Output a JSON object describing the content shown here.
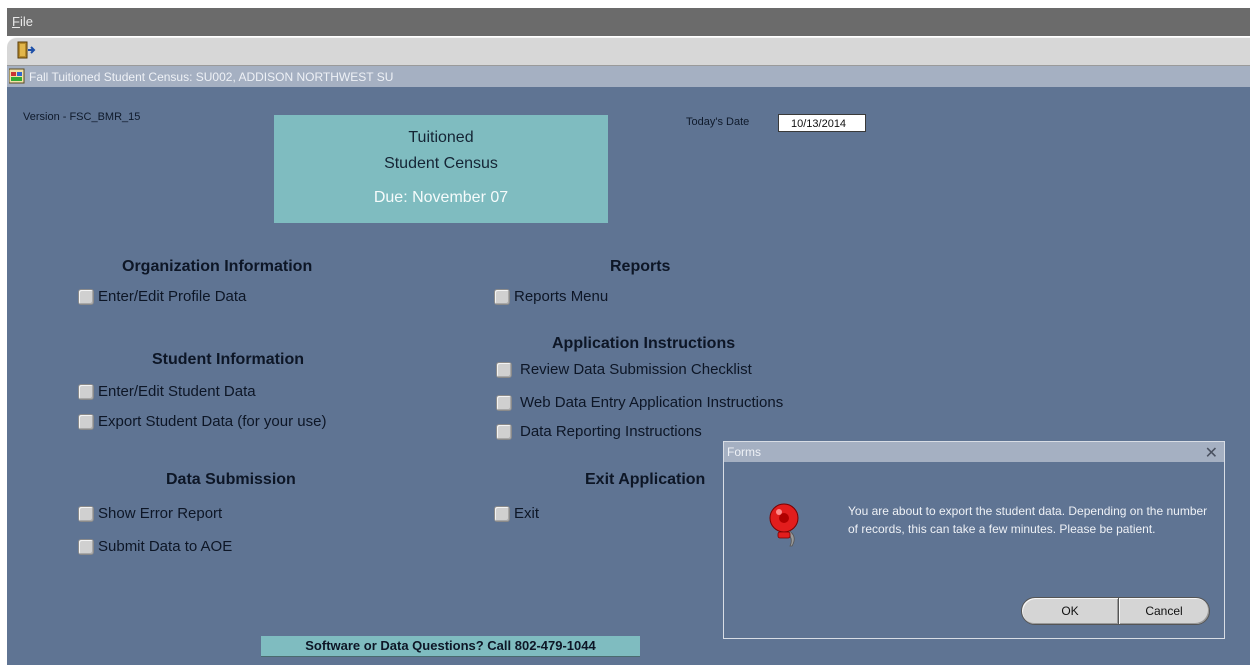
{
  "menu": {
    "file": "File"
  },
  "window_title": "Fall Tuitioned Student Census:  SU002, ADDISON NORTHWEST SU",
  "version": "Version - FSC_BMR_15",
  "banner": {
    "line1": "Tuitioned",
    "line2": "Student Census",
    "due": "Due:  November 07"
  },
  "today_label": "Today's Date",
  "today_value": "10/13/2014",
  "sections": {
    "org": {
      "title": "Organization Information",
      "items": [
        "Enter/Edit Profile Data"
      ]
    },
    "student": {
      "title": "Student Information",
      "items": [
        "Enter/Edit Student Data",
        "Export Student Data (for your use)"
      ]
    },
    "submission": {
      "title": "Data Submission",
      "items": [
        "Show Error Report",
        "Submit Data to AOE"
      ]
    },
    "reports": {
      "title": "Reports",
      "items": [
        "Reports Menu"
      ]
    },
    "instructions": {
      "title": "Application Instructions",
      "items": [
        "Review Data Submission Checklist",
        "Web Data Entry Application Instructions",
        "Data Reporting Instructions"
      ]
    },
    "exit": {
      "title": "Exit Application",
      "items": [
        "Exit"
      ]
    }
  },
  "footer": "Software or Data Questions?  Call 802-479-1044",
  "dialog": {
    "title": "Forms",
    "message": "You are about to export the student data.  Depending on the number of records, this can take a few minutes. Please be patient.",
    "ok": "OK",
    "cancel": "Cancel"
  },
  "colors": {
    "background": "#5f7493",
    "banner": "#7fbcc0",
    "titlebar": "#a5b0c2"
  },
  "icons": {
    "exit": "exit-door-icon",
    "window": "form-window-icon",
    "dialog": "alarm-bell-icon",
    "close": "close-icon"
  }
}
